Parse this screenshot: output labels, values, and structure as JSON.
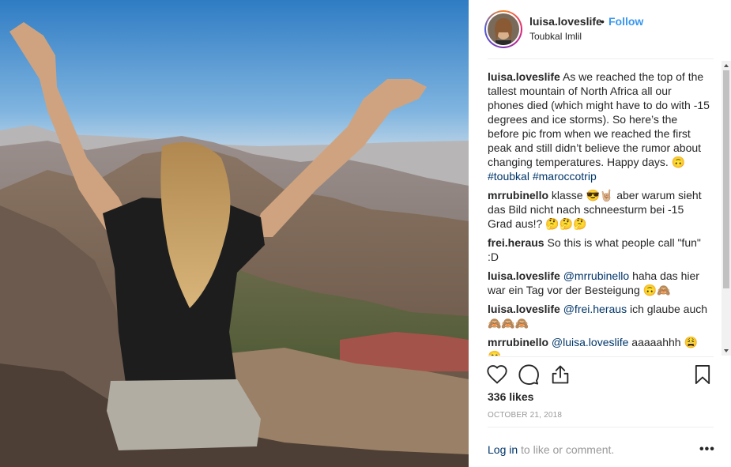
{
  "post": {
    "username": "luisa.loveslife",
    "separator": "•",
    "follow_label": "Follow",
    "location": "Toubkal Imlil",
    "likes": "336 likes",
    "date": "OCTOBER 21, 2018",
    "login_label": "Log in",
    "login_suffix": " to like or comment.",
    "more_label": "•••"
  },
  "caption": {
    "author": "luisa.loveslife",
    "text": " As we reached the top of the tallest mountain of North Africa all our phones died (which might have to do with -15 degrees and ice storms). So here’s the before pic from when we reached the first peak and still didn’t believe the rumor about changing temperatures. Happy days. 🙃 ",
    "hashtag1": "#toubkal",
    "hashtag2": "#maroccotrip"
  },
  "comments": [
    {
      "author": "mrrubinello",
      "mention": "",
      "text": " klasse 😎🤘🏼 aber warum sieht das Bild nicht nach schneesturm bei -15 Grad aus!? 🤔🤔🤔"
    },
    {
      "author": "frei.heraus",
      "mention": "",
      "text": " So this is what people call \"fun\" :D"
    },
    {
      "author": "luisa.loveslife",
      "mention": "@mrrubinello",
      "text": " haha das hier war ein Tag vor der Besteigung 🙃🙈"
    },
    {
      "author": "luisa.loveslife",
      "mention": "@frei.heraus",
      "text": " ich glaube auch 🙈🙈🙈"
    },
    {
      "author": "mrrubinello",
      "mention": "@luisa.loveslife",
      "text": " aaaaahhh 😩😄"
    }
  ],
  "icons": {
    "like": "heart-icon",
    "comment": "comment-icon",
    "share": "share-icon",
    "save": "bookmark-icon",
    "more": "more-options-icon"
  },
  "colors": {
    "link": "#3897f0",
    "mention": "#003569",
    "muted": "#999999",
    "text": "#262626"
  }
}
